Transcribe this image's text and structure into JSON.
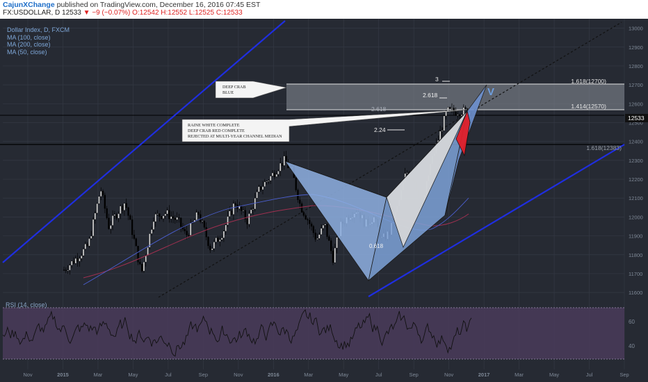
{
  "header": {
    "author": "CajunXChange",
    "published": "published on TradingView.com, December 16, 2016 07:45 EST",
    "symbol": "FX:USDOLLAR, D",
    "price": "12533",
    "change": "−9 (−0.07%)",
    "open": "O:12542",
    "high": "H:12552",
    "low": "L:12525",
    "close": "C:12533"
  },
  "legend": {
    "series_name": "Dollar Index, D, FXCM",
    "ma100": "MA (100, close)",
    "ma200": "MA (200, close)",
    "ma50": "MA (50, close)"
  },
  "rsi": {
    "label": "RSI (14, close)"
  },
  "annotations": {
    "deep_crab_blue": [
      "DEEP CRAB",
      "BLUE"
    ],
    "complete_note": [
      "RAINE WHITE COMPLETE",
      "DEEP CRAB RED COMPLETE",
      "REJECTED AT MULTI-YEAR CHANNEL MEDIAN"
    ],
    "fib_3": "3",
    "fib_2618_top": "2.618",
    "fib_2618_line": "2.618",
    "fib_224": "2.24",
    "fib_0618": "0.618",
    "fib_1618_12700": "1.618(12700)",
    "fib_1414_12570": "1.414(12570)",
    "fib_1618_low": "1.618(12383)",
    "v_mark": "V",
    "price_tag": "12533"
  },
  "colors": {
    "background": "#262a33",
    "grid": "#343944",
    "channel": "#1f2ee0",
    "pattern_blue": "#8fb1e3",
    "pattern_white": "#d9d9d9",
    "pattern_red": "#e01f2a",
    "rsi_band": "#4a3b5b",
    "candle": "#000000"
  },
  "chart_data": {
    "type": "candlestick",
    "y_axis_ticks": [
      13000,
      12900,
      12800,
      12700,
      12600,
      12500,
      12400,
      12300,
      12200,
      12100,
      12000,
      11900,
      11800,
      11700,
      11600
    ],
    "ylim": [
      11560,
      13050
    ],
    "x_axis_labels": [
      "Nov",
      "2015",
      "Mar",
      "May",
      "Jul",
      "Sep",
      "Nov",
      "2016",
      "Mar",
      "May",
      "Jul",
      "Sep",
      "Nov",
      "2017",
      "Mar",
      "May",
      "Jul",
      "Sep"
    ],
    "rsi_ticks": [
      60,
      40
    ],
    "rsi_range": [
      25,
      80
    ],
    "close_path": [
      [
        0,
        11720
      ],
      [
        0.03,
        11780
      ],
      [
        0.06,
        11850
      ],
      [
        0.09,
        12150
      ],
      [
        0.11,
        11950
      ],
      [
        0.13,
        12020
      ],
      [
        0.15,
        12080
      ],
      [
        0.17,
        11900
      ],
      [
        0.19,
        11700
      ],
      [
        0.22,
        12000
      ],
      [
        0.25,
        12020
      ],
      [
        0.28,
        11980
      ],
      [
        0.3,
        11900
      ],
      [
        0.33,
        12020
      ],
      [
        0.36,
        11830
      ],
      [
        0.39,
        11920
      ],
      [
        0.42,
        12080
      ],
      [
        0.45,
        11980
      ],
      [
        0.48,
        12150
      ],
      [
        0.51,
        12220
      ],
      [
        0.54,
        12300
      ],
      [
        0.56,
        12240
      ],
      [
        0.58,
        12060
      ],
      [
        0.6,
        11980
      ],
      [
        0.62,
        11880
      ],
      [
        0.64,
        11960
      ],
      [
        0.66,
        11780
      ],
      [
        0.68,
        11960
      ],
      [
        0.7,
        12010
      ],
      [
        0.72,
        12040
      ],
      [
        0.74,
        11960
      ],
      [
        0.76,
        12000
      ],
      [
        0.78,
        11880
      ],
      [
        0.8,
        11920
      ],
      [
        0.82,
        12060
      ],
      [
        0.84,
        12240
      ],
      [
        0.86,
        12200
      ],
      [
        0.88,
        12060
      ],
      [
        0.9,
        12280
      ],
      [
        0.92,
        12420
      ],
      [
        0.94,
        12560
      ]
    ],
    "levels": [
      {
        "label": "1.618(12700)",
        "value": 12700
      },
      {
        "label": "1.414(12570)",
        "value": 12570
      },
      {
        "label": "1.618(12383)",
        "value": 12383
      }
    ],
    "last_price": 12533
  }
}
